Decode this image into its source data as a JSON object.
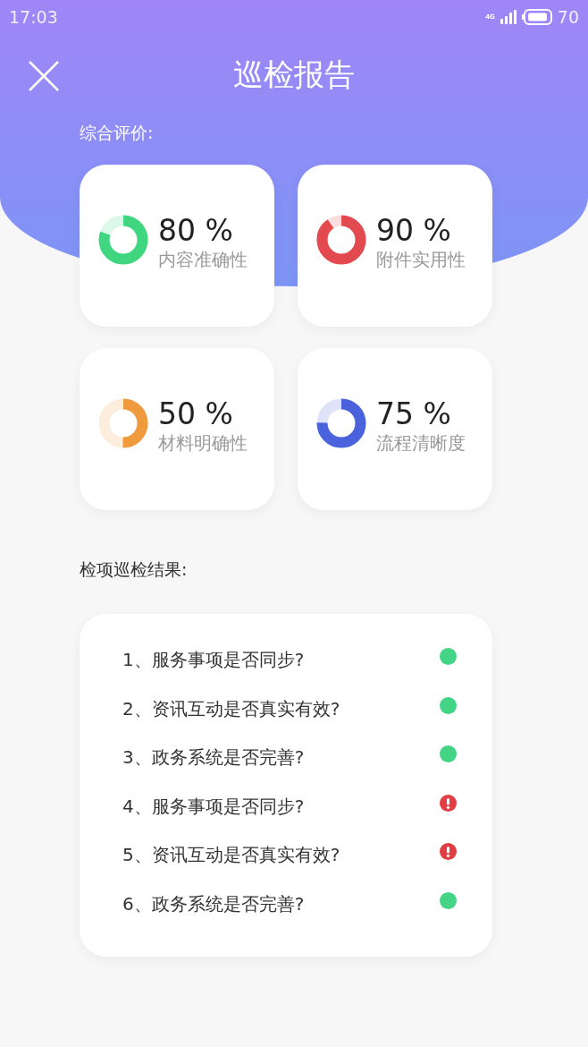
{
  "status_bar": {
    "time": "17:03",
    "network": "4G",
    "battery": "70"
  },
  "header": {
    "title": "巡检报告"
  },
  "overall": {
    "label": "综合评价:",
    "metrics": [
      {
        "value": "80 %",
        "name": "内容准确性",
        "color": "#3fd67f"
      },
      {
        "value": "90 %",
        "name": "附件实用性",
        "color": "#e24a4f"
      },
      {
        "value": "50 %",
        "name": "材料明确性",
        "color": "#f09a3e"
      },
      {
        "value": "75 %",
        "name": "流程清晰度",
        "color": "#4a63dc"
      }
    ]
  },
  "results": {
    "label": "检项巡检结果:",
    "items": [
      {
        "text": "1、服务事项是否同步?",
        "kind": "ok"
      },
      {
        "text": "2、资讯互动是否真实有效?",
        "kind": "ok"
      },
      {
        "text": "3、政务系统是否完善?",
        "kind": "ok"
      },
      {
        "text": "4、服务事项是否同步?",
        "kind": "warning"
      },
      {
        "text": "5、资讯互动是否真实有效?",
        "kind": "warning"
      },
      {
        "text": "6、政务系统是否完善?",
        "kind": "ok"
      }
    ]
  }
}
